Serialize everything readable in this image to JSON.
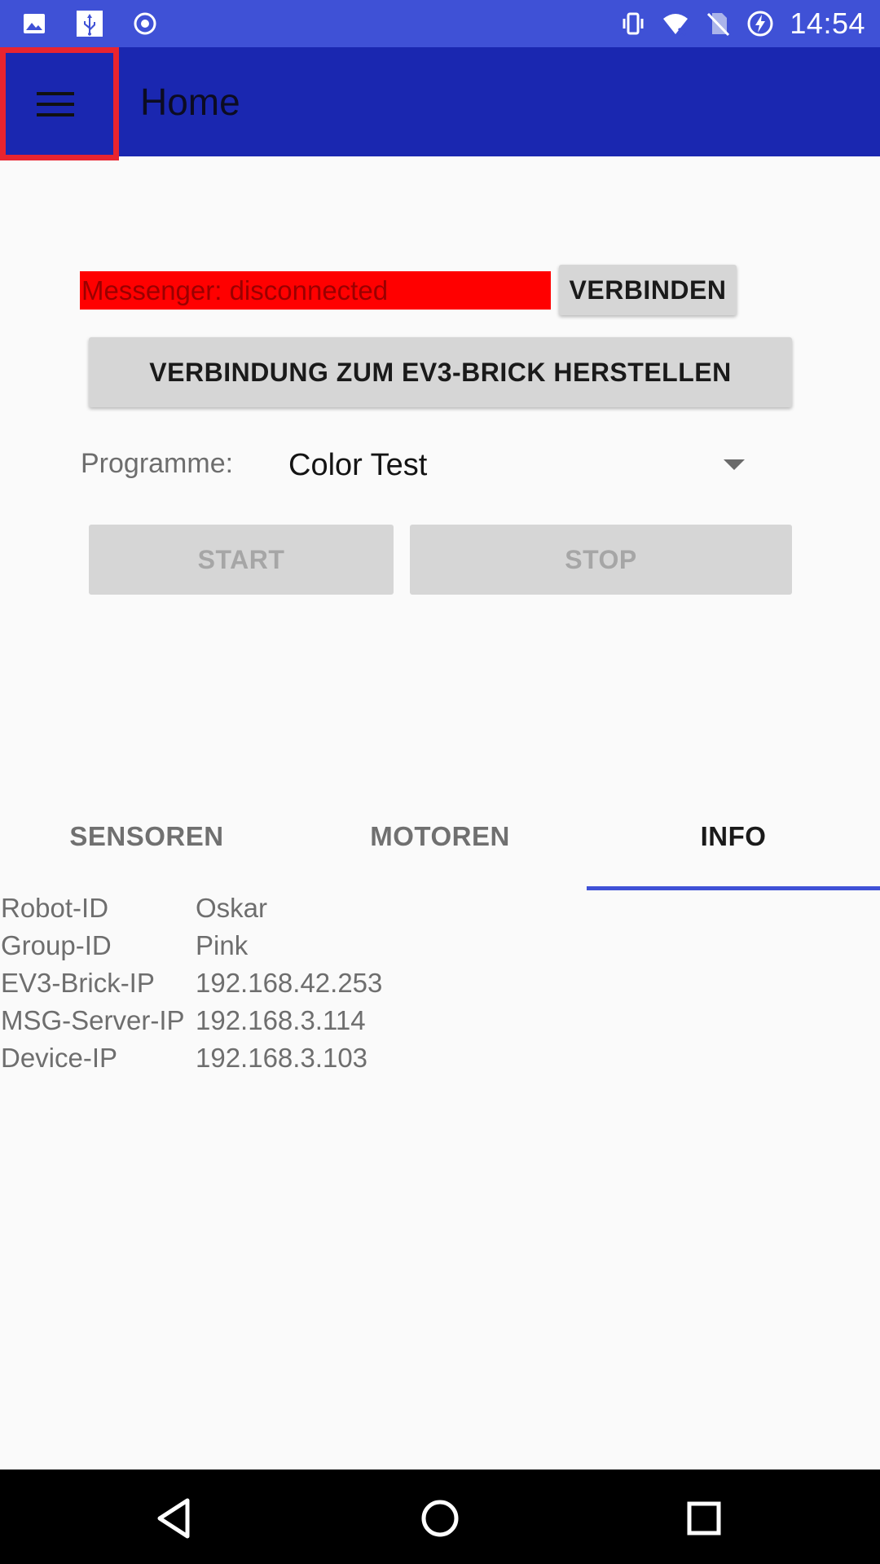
{
  "status_bar": {
    "time": "14:54",
    "left_icons": [
      "image-icon",
      "usb-icon",
      "record-icon"
    ],
    "right_icons": [
      "vibrate-icon",
      "wifi-icon",
      "no-sim-icon",
      "battery-charging-icon"
    ]
  },
  "app_bar": {
    "title": "Home",
    "menu_icon": "hamburger-menu-icon"
  },
  "main": {
    "messenger_status": "Messenger: disconnected",
    "connect_button": "VERBINDEN",
    "ev3_connect_button": "VERBINDUNG ZUM EV3-BRICK HERSTELLEN",
    "program_label": "Programme:",
    "program_selected": "Color Test",
    "start_button": "START",
    "stop_button": "STOP"
  },
  "tabs": [
    {
      "label": "SENSOREN",
      "selected": false
    },
    {
      "label": "MOTOREN",
      "selected": false
    },
    {
      "label": "INFO",
      "selected": true
    }
  ],
  "info": {
    "rows": [
      {
        "key": "Robot-ID",
        "value": "Oskar"
      },
      {
        "key": "Group-ID",
        "value": "Pink"
      },
      {
        "key": "EV3-Brick-IP",
        "value": "192.168.42.253"
      },
      {
        "key": "MSG-Server-IP",
        "value": "192.168.3.114"
      },
      {
        "key": "Device-IP",
        "value": "192.168.3.103"
      }
    ]
  },
  "nav_bar": {
    "icons": [
      "back-icon",
      "home-icon",
      "recents-icon"
    ]
  },
  "colors": {
    "status_bar": "#3f51d6",
    "app_bar": "#1a27b0",
    "highlight_border": "#e8242f",
    "messenger_status_bg": "#ff0000",
    "tab_indicator": "#3f51d6"
  }
}
